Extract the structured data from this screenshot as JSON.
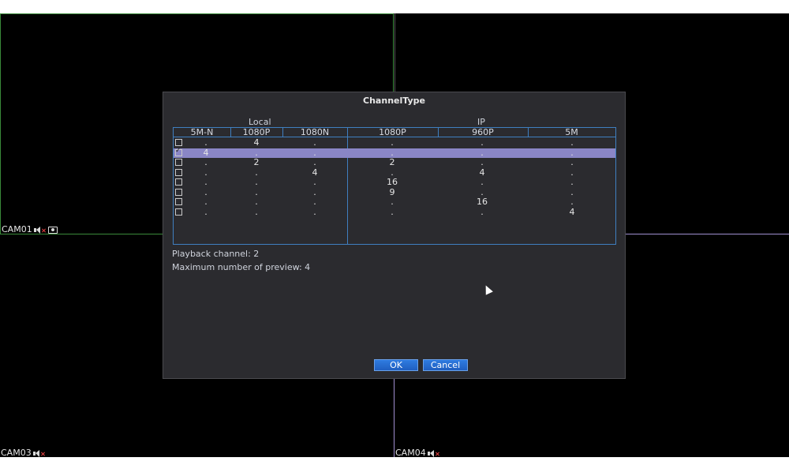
{
  "cameras": [
    {
      "name": "CAM01",
      "icons": [
        "speaker-muted-icon",
        "record-icon"
      ]
    },
    {
      "name": "CAM03",
      "icons": [
        "speaker-muted-icon"
      ]
    },
    {
      "name": "CAM04",
      "icons": [
        "speaker-muted-icon"
      ]
    }
  ],
  "dialog": {
    "title": "ChannelType",
    "groups": {
      "local": "Local",
      "ip": "IP"
    },
    "columns": [
      "5M-N",
      "1080P",
      "1080N",
      "1080P",
      "960P",
      "5M"
    ],
    "rows": [
      {
        "checked": false,
        "selected": false,
        "values": [
          ".",
          "4",
          ".",
          ".",
          ".",
          "."
        ]
      },
      {
        "checked": true,
        "selected": true,
        "values": [
          "4",
          ".",
          ".",
          ".",
          ".",
          "."
        ]
      },
      {
        "checked": false,
        "selected": false,
        "values": [
          ".",
          "2",
          ".",
          "2",
          ".",
          "."
        ]
      },
      {
        "checked": false,
        "selected": false,
        "values": [
          ".",
          ".",
          "4",
          ".",
          "4",
          "."
        ]
      },
      {
        "checked": false,
        "selected": false,
        "values": [
          ".",
          ".",
          ".",
          "16",
          ".",
          "."
        ]
      },
      {
        "checked": false,
        "selected": false,
        "values": [
          ".",
          ".",
          ".",
          "9",
          ".",
          "."
        ]
      },
      {
        "checked": false,
        "selected": false,
        "values": [
          ".",
          ".",
          ".",
          ".",
          "16",
          "."
        ]
      },
      {
        "checked": false,
        "selected": false,
        "values": [
          ".",
          ".",
          ".",
          ".",
          ".",
          "4"
        ]
      }
    ],
    "playback": "Playback channel: 2",
    "max_preview": "Maximum number of preview: 4",
    "ok_label": "OK",
    "cancel_label": "Cancel"
  },
  "colors": {
    "accent": "#3f7fc0",
    "selected_row": "#8a86c6",
    "button": "#2f7be0",
    "cam_border_green": "#3a8a3a",
    "cam_border_purple": "#a08fd0"
  }
}
